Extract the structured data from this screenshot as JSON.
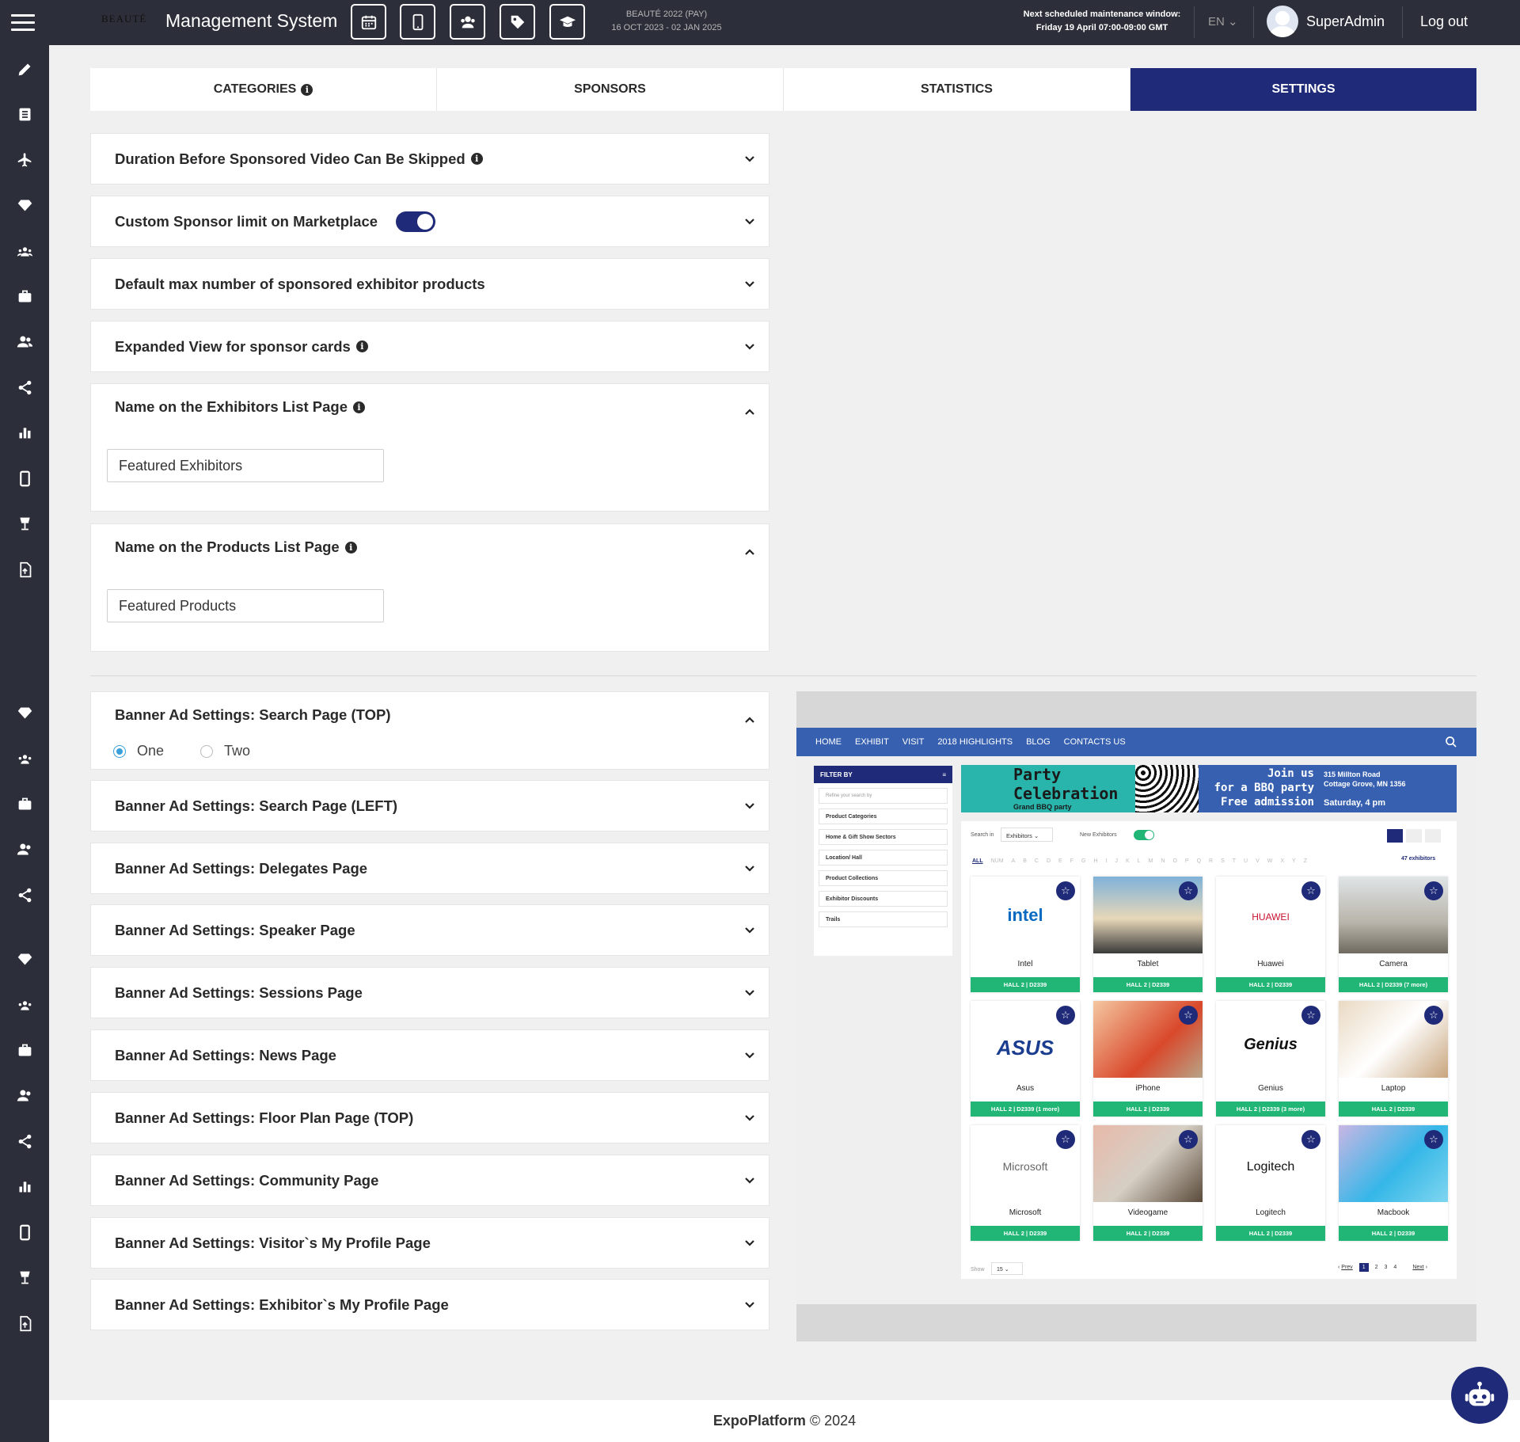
{
  "header": {
    "brand_logo": "BEAUTÉ",
    "title": "Management System",
    "event_name": "BEAUTÉ 2022 (PAY)",
    "event_dates": "16 OCT 2023 - 02 JAN 2025",
    "maintenance_line1": "Next scheduled maintenance window:",
    "maintenance_line2": "Friday 19 April 07:00-09:00 GMT",
    "language": "EN",
    "user": "SuperAdmin",
    "logout": "Log out",
    "tool_icons": [
      "calendar-icon",
      "mobile-icon",
      "users-icon",
      "tag-icon",
      "graduation-cap-icon"
    ]
  },
  "tabs": [
    "CATEGORIES",
    "SPONSORS",
    "STATISTICS",
    "SETTINGS"
  ],
  "active_tab": "SETTINGS",
  "settings": {
    "video_skip": "Duration Before Sponsored Video Can Be Skipped",
    "custom_limit": "Custom Sponsor limit on Marketplace",
    "custom_limit_enabled": true,
    "max_products": "Default max number of sponsored exhibitor products",
    "expanded_view": "Expanded View for sponsor cards",
    "exhibitors_name": {
      "label": "Name on the Exhibitors List Page",
      "value": "Featured Exhibitors"
    },
    "products_name": {
      "label": "Name on the Products List Page",
      "value": "Featured Products"
    }
  },
  "banners": {
    "search_top": {
      "label": "Banner Ad Settings: Search Page (TOP)",
      "options": [
        "One",
        "Two"
      ],
      "selected": "One"
    },
    "search_left": "Banner Ad Settings: Search Page (LEFT)",
    "delegates": "Banner Ad Settings: Delegates Page",
    "speaker": "Banner Ad Settings: Speaker Page",
    "sessions": "Banner Ad Settings: Sessions Page",
    "news": "Banner Ad Settings: News Page",
    "floorplan": "Banner Ad Settings: Floor Plan Page (TOP)",
    "community": "Banner Ad Settings: Community Page",
    "visitor_profile": "Banner Ad Settings: Visitor`s My Profile Page",
    "exhibitor_profile": "Banner Ad Settings: Exhibitor`s My Profile Page"
  },
  "preview": {
    "nav": [
      "HOME",
      "EXHIBIT",
      "VISIT",
      "2018 HIGHLIGHTS",
      "BLOG",
      "CONTACTS US"
    ],
    "filter_title": "FILTER BY",
    "filter_search": "Refine your search by",
    "filters": [
      "Product Categories",
      "Home & Gift Show Sectors",
      "Location/ Hall",
      "Product Collections",
      "Exhibitor Discounts",
      "Trails"
    ],
    "banner": {
      "title1": "Party",
      "title2": "Celebration",
      "sub": "Grand BBQ party",
      "join1": "Join us",
      "join2": "for a BBQ party",
      "join3": "Free admission",
      "addr1": "315 Millton Road",
      "addr2": "Cottage Grove, MN 1356",
      "when": "Saturday, 4 pm"
    },
    "search_in_label": "Search in",
    "search_in_value": "Exhibitors",
    "new_exhibitors": "New Exhibitors",
    "letters": [
      "ALL",
      "NUM",
      "A",
      "B",
      "C",
      "D",
      "E",
      "F",
      "G",
      "H",
      "I",
      "J",
      "K",
      "L",
      "M",
      "N",
      "O",
      "P",
      "Q",
      "R",
      "S",
      "T",
      "U",
      "V",
      "W",
      "X",
      "Y",
      "Z"
    ],
    "count": "47 exhibitors",
    "cards": [
      {
        "name": "Intel",
        "hall": "HALL 2 | D2339",
        "logo": "intel"
      },
      {
        "name": "Tablet",
        "hall": "HALL 2 | D2339",
        "logo": "photo-street"
      },
      {
        "name": "Huawei",
        "hall": "HALL 2 | D2339",
        "logo": "HUAWEI"
      },
      {
        "name": "Camera",
        "hall": "HALL 2 | D2339 (7 more)",
        "logo": "photo-beach"
      },
      {
        "name": "Asus",
        "hall": "HALL 2 | D2339 (1 more)",
        "logo": "ASUS"
      },
      {
        "name": "iPhone",
        "hall": "HALL 2 | D2339",
        "logo": "photo-woman"
      },
      {
        "name": "Genius",
        "hall": "HALL 2 | D2339 (3 more)",
        "logo": "Genius"
      },
      {
        "name": "Laptop",
        "hall": "HALL 2 | D2339",
        "logo": "photo-laptop"
      },
      {
        "name": "Microsoft",
        "hall": "HALL 2 | D2339",
        "logo": "Microsoft"
      },
      {
        "name": "Videogame",
        "hall": "HALL 2 | D2339",
        "logo": "photo-hat"
      },
      {
        "name": "Logitech",
        "hall": "HALL 2 | D2339",
        "logo": "Logitech"
      },
      {
        "name": "Macbook",
        "hall": "HALL 2 | D2339",
        "logo": "photo-fabric"
      }
    ],
    "show_label": "Show",
    "show_value": "15",
    "pagination": {
      "prev": "Prev",
      "pages": [
        "1",
        "2",
        "3",
        "4"
      ],
      "current": "1",
      "next": "Next"
    }
  },
  "footer": {
    "brand": "ExpoPlatform",
    "copy": "© 2024"
  },
  "colors": {
    "nav_dark": "#2c2e39",
    "accent_blue": "#1f2a78",
    "green": "#21b576"
  }
}
